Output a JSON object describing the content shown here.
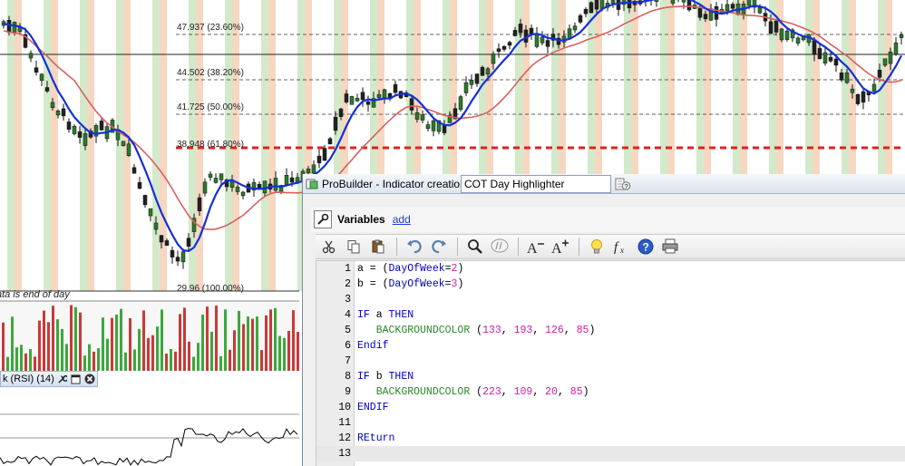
{
  "chart": {
    "fib_levels": [
      {
        "label": "47.937 (23.60%)"
      },
      {
        "label": "44.502 (38.20%)"
      },
      {
        "label": "41.725 (50.00%)"
      },
      {
        "label": "38.948 (61.80%)"
      },
      {
        "label": "29.96 (100.00%)"
      }
    ],
    "note": "ata is end of day",
    "colors": {
      "bg_green": "#bfe0b0",
      "bg_orange": "#f2c4a5",
      "fast_ma": "#1430d8",
      "slow_ma": "#d96060",
      "fib_highlight": "#e02020",
      "candle_up": "#2c7a2c",
      "candle_down": "#222222",
      "volume_up": "#3ca83c",
      "volume_down": "#c83a3a"
    }
  },
  "rsi_panel": {
    "title": "k (RSI) (14)",
    "icons": [
      "wrench-icon",
      "maximize-icon",
      "close-icon"
    ]
  },
  "probuilder": {
    "window_title": "ProBuilder - Indicator creation",
    "separator": "-",
    "indicator_name": "COT Day Highlighter",
    "variables_label": "Variables",
    "add_link": "add",
    "toolbar_icons": [
      "cut-icon",
      "copy-icon",
      "paste-icon",
      "undo-icon",
      "redo-icon",
      "search-icon",
      "comment-icon",
      "font-decrease-icon",
      "font-increase-icon",
      "lightbulb-icon",
      "function-icon",
      "help-icon",
      "print-icon"
    ],
    "code_lines": [
      {
        "n": "1",
        "tokens": [
          {
            "t": "pl",
            "v": "a = ("
          },
          {
            "t": "kw",
            "v": "DayOfWeek"
          },
          {
            "t": "pl",
            "v": "="
          },
          {
            "t": "num",
            "v": "2"
          },
          {
            "t": "pl",
            "v": ")"
          }
        ]
      },
      {
        "n": "2",
        "tokens": [
          {
            "t": "pl",
            "v": "b = ("
          },
          {
            "t": "kw",
            "v": "DayOfWeek"
          },
          {
            "t": "pl",
            "v": "="
          },
          {
            "t": "num",
            "v": "3"
          },
          {
            "t": "pl",
            "v": ")"
          }
        ]
      },
      {
        "n": "3",
        "tokens": []
      },
      {
        "n": "4",
        "tokens": [
          {
            "t": "kw",
            "v": "IF"
          },
          {
            "t": "pl",
            "v": " a "
          },
          {
            "t": "kw",
            "v": "THEN"
          }
        ]
      },
      {
        "n": "5",
        "tokens": [
          {
            "t": "pl",
            "v": "   "
          },
          {
            "t": "fn",
            "v": "BACKGROUNDCOLOR"
          },
          {
            "t": "pl",
            "v": " ("
          },
          {
            "t": "num",
            "v": "133"
          },
          {
            "t": "pl",
            "v": ", "
          },
          {
            "t": "num",
            "v": "193"
          },
          {
            "t": "pl",
            "v": ", "
          },
          {
            "t": "num",
            "v": "126"
          },
          {
            "t": "pl",
            "v": ", "
          },
          {
            "t": "num",
            "v": "85"
          },
          {
            "t": "pl",
            "v": ")"
          }
        ]
      },
      {
        "n": "6",
        "tokens": [
          {
            "t": "kw",
            "v": "Endif"
          }
        ]
      },
      {
        "n": "7",
        "tokens": []
      },
      {
        "n": "8",
        "tokens": [
          {
            "t": "kw",
            "v": "IF"
          },
          {
            "t": "pl",
            "v": " b "
          },
          {
            "t": "kw",
            "v": "THEN"
          }
        ]
      },
      {
        "n": "9",
        "tokens": [
          {
            "t": "pl",
            "v": "   "
          },
          {
            "t": "fn",
            "v": "BACKGROUNDCOLOR"
          },
          {
            "t": "pl",
            "v": " ("
          },
          {
            "t": "num",
            "v": "223"
          },
          {
            "t": "pl",
            "v": ", "
          },
          {
            "t": "num",
            "v": "109"
          },
          {
            "t": "pl",
            "v": ", "
          },
          {
            "t": "num",
            "v": "20"
          },
          {
            "t": "pl",
            "v": ", "
          },
          {
            "t": "num",
            "v": "85"
          },
          {
            "t": "pl",
            "v": ")"
          }
        ]
      },
      {
        "n": "10",
        "tokens": [
          {
            "t": "kw",
            "v": "ENDIF"
          }
        ]
      },
      {
        "n": "11",
        "tokens": []
      },
      {
        "n": "12",
        "tokens": [
          {
            "t": "kw",
            "v": "REturn"
          }
        ]
      },
      {
        "n": "13",
        "tokens": []
      }
    ],
    "current_line": "13"
  }
}
